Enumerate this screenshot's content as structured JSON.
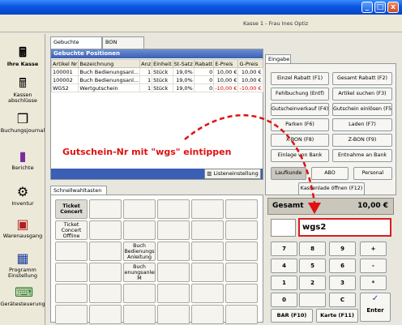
{
  "window": {
    "title": "Kasse 1 - Frau Ines Optiz",
    "buttons": {
      "minimize": "_",
      "maximize": "□",
      "close": "x"
    }
  },
  "nav": {
    "items": [
      {
        "label": "Ihre Kasse",
        "icon": "cash-register-icon"
      },
      {
        "label": "Kassen abschlüsse",
        "icon": "register-close-icon"
      },
      {
        "label": "Buchungsjournal",
        "icon": "journal-icon"
      },
      {
        "label": "Berichte",
        "icon": "report-icon"
      },
      {
        "label": "Inventur",
        "icon": "inventory-icon"
      },
      {
        "label": "Warenausgang",
        "icon": "goods-out-icon"
      },
      {
        "label": "Programm Einstellung",
        "icon": "settings-icon"
      },
      {
        "label": "Gerätesteuerung",
        "icon": "device-icon"
      }
    ]
  },
  "left": {
    "tabs": [
      "Gebuchte Artikel...",
      "BON Journal..."
    ],
    "panel_title": "Gebuchte Positionen",
    "columns": [
      "Artikel Nr",
      "Bezeichnung",
      "Anz",
      "Einheit",
      "St-Satz",
      "Rabatt",
      "E-Preis",
      "G-Preis"
    ],
    "rows": [
      [
        "100001",
        "Buch Bedienungsanl...",
        "1",
        "Stück",
        "19,0%",
        "0",
        "10,00 €",
        "10,00 €"
      ],
      [
        "100002",
        "Buch Bedienungsanl...",
        "1",
        "Stück",
        "19,0%",
        "0",
        "10,00 €",
        "10,00 €"
      ],
      [
        "WGS2",
        "Wertgutschein",
        "1",
        "Stück",
        "19,0%",
        "0",
        "-10,00 €",
        "-10,00 €"
      ]
    ],
    "list_settings_label": "Listeneinstellung"
  },
  "quick": {
    "tab": "Schnellwahltasten",
    "buttons": [
      "Ticket Concert",
      "",
      "",
      "",
      "",
      "",
      "Ticket Concert Offline",
      "",
      "",
      "",
      "",
      "",
      "",
      "",
      "Buch Bedienungs Anleitung",
      "",
      "",
      "",
      "",
      "",
      "Buch dienungsanleit. M",
      "",
      "",
      "",
      "",
      "",
      "",
      "",
      "",
      "",
      "",
      "",
      "",
      "",
      "",
      ""
    ]
  },
  "right": {
    "tab": "Eingabe",
    "functions": [
      "Einzel Rabatt (F1)",
      "Gesamt Rabatt (F2)",
      "Fehlbuchung (Entf)",
      "Artikel suchen (F3)",
      "Gutscheinverkauf (F4)",
      "Gutschein einlösen (F5)",
      "Parken (F6)",
      "Laden (F7)",
      "X-BON (F8)",
      "Z-BON (F9)",
      "Einlage von Bank",
      "Entnahme an Bank"
    ],
    "customer_types": [
      "Laufkunde",
      "ABO",
      "Personal"
    ],
    "drawer_label": "Kassenlade öffnen (F12)",
    "total_label": "Gesamt",
    "total_value": "10,00 €",
    "input_value": "wgs2",
    "keypad": [
      "7",
      "8",
      "9",
      "+",
      "4",
      "5",
      "6",
      "-",
      "1",
      "2",
      "3",
      "*",
      "0",
      "",
      "C",
      "✓"
    ],
    "bar_label": "BAR (F10)",
    "card_label": "Karte (F11)",
    "enter_label": "Enter"
  },
  "annotation": "Gutschein-Nr mit \"wgs\" eintippen",
  "colors": {
    "accent": "#3a5fb5",
    "annotation": "#e01010",
    "negative": "#d00000"
  }
}
